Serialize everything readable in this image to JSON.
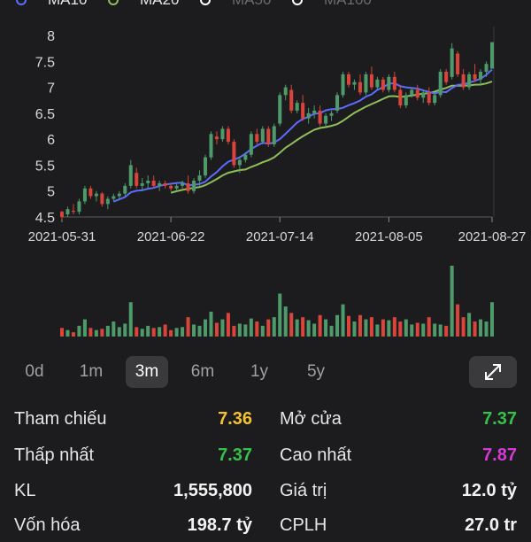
{
  "legend": [
    {
      "label": "MA10",
      "color": "#5b6cff"
    },
    {
      "label": "MA20",
      "color": "#8fbf5a"
    },
    {
      "label": "MA50",
      "color": "#6b6b6b"
    },
    {
      "label": "MA100",
      "color": "#6b6b6b"
    }
  ],
  "chart_data": {
    "type": "candlestick",
    "x_ticks": [
      "2021-05-31",
      "2021-06-22",
      "2021-07-14",
      "2021-08-05",
      "2021-08-27"
    ],
    "y_ticks": [
      "4.5",
      "5",
      "5.5",
      "6",
      "6.5",
      "7",
      "7.5",
      "8"
    ],
    "ylim": [
      4.5,
      8
    ],
    "up_color": "#4f9a6a",
    "down_color": "#d9443b",
    "candles": [
      [
        4.6,
        4.62,
        4.45,
        4.5
      ],
      [
        4.55,
        4.7,
        4.5,
        4.65
      ],
      [
        4.62,
        4.75,
        4.55,
        4.6
      ],
      [
        4.6,
        4.85,
        4.55,
        4.8
      ],
      [
        4.8,
        5.1,
        4.75,
        5.05
      ],
      [
        5.05,
        5.1,
        4.85,
        4.9
      ],
      [
        4.9,
        5.0,
        4.8,
        4.95
      ],
      [
        4.95,
        4.98,
        4.7,
        4.75
      ],
      [
        4.75,
        4.9,
        4.65,
        4.85
      ],
      [
        4.85,
        4.95,
        4.8,
        4.9
      ],
      [
        4.9,
        5.0,
        4.85,
        4.95
      ],
      [
        4.95,
        5.15,
        4.9,
        5.1
      ],
      [
        5.1,
        5.6,
        5.05,
        5.5
      ],
      [
        5.35,
        5.45,
        5.05,
        5.1
      ],
      [
        5.1,
        5.25,
        5.0,
        5.15
      ],
      [
        5.15,
        5.3,
        5.05,
        5.2
      ],
      [
        5.2,
        5.3,
        5.05,
        5.1
      ],
      [
        5.1,
        5.2,
        5.0,
        5.15
      ],
      [
        5.15,
        5.2,
        5.05,
        5.1
      ],
      [
        5.1,
        5.15,
        5.0,
        5.05
      ],
      [
        5.05,
        5.15,
        5.0,
        5.1
      ],
      [
        5.1,
        5.2,
        5.05,
        5.15
      ],
      [
        5.15,
        5.3,
        4.95,
        5.0
      ],
      [
        5.0,
        5.25,
        4.95,
        5.2
      ],
      [
        5.2,
        5.4,
        5.1,
        5.3
      ],
      [
        5.3,
        5.7,
        5.25,
        5.65
      ],
      [
        5.65,
        6.15,
        5.6,
        6.1
      ],
      [
        6.05,
        6.15,
        5.9,
        6.0
      ],
      [
        6.0,
        6.25,
        5.95,
        6.2
      ],
      [
        6.2,
        6.25,
        5.9,
        5.95
      ],
      [
        5.95,
        6.0,
        5.45,
        5.5
      ],
      [
        5.5,
        5.65,
        5.35,
        5.6
      ],
      [
        5.6,
        5.75,
        5.55,
        5.7
      ],
      [
        5.7,
        6.15,
        5.65,
        6.1
      ],
      [
        6.1,
        6.2,
        5.9,
        5.95
      ],
      [
        5.95,
        6.25,
        5.9,
        6.2
      ],
      [
        6.2,
        6.25,
        5.85,
        5.9
      ],
      [
        5.9,
        6.3,
        5.85,
        6.25
      ],
      [
        6.3,
        6.9,
        6.25,
        6.85
      ],
      [
        6.85,
        7.05,
        6.75,
        7.0
      ],
      [
        6.95,
        7.05,
        6.5,
        6.55
      ],
      [
        6.55,
        6.75,
        6.5,
        6.7
      ],
      [
        6.7,
        6.85,
        6.35,
        6.4
      ],
      [
        6.4,
        6.6,
        6.3,
        6.5
      ],
      [
        6.5,
        6.65,
        6.4,
        6.55
      ],
      [
        6.55,
        6.65,
        6.25,
        6.3
      ],
      [
        6.3,
        6.5,
        6.25,
        6.45
      ],
      [
        6.45,
        6.55,
        6.35,
        6.5
      ],
      [
        6.55,
        6.9,
        6.5,
        6.85
      ],
      [
        6.85,
        7.3,
        6.8,
        7.25
      ],
      [
        7.25,
        7.3,
        7.0,
        7.05
      ],
      [
        7.05,
        7.15,
        6.95,
        7.1
      ],
      [
        7.1,
        7.25,
        6.85,
        6.9
      ],
      [
        6.9,
        7.3,
        6.85,
        7.25
      ],
      [
        7.25,
        7.4,
        6.95,
        7.0
      ],
      [
        7.0,
        7.2,
        6.95,
        7.15
      ],
      [
        7.15,
        7.2,
        6.9,
        6.95
      ],
      [
        6.95,
        7.25,
        6.9,
        7.2
      ],
      [
        7.2,
        7.3,
        6.9,
        6.95
      ],
      [
        6.95,
        7.05,
        6.6,
        6.65
      ],
      [
        6.65,
        6.9,
        6.6,
        6.85
      ],
      [
        6.85,
        7.0,
        6.8,
        6.95
      ],
      [
        6.95,
        7.05,
        6.75,
        6.8
      ],
      [
        6.8,
        6.95,
        6.7,
        6.9
      ],
      [
        6.9,
        7.0,
        6.65,
        6.7
      ],
      [
        6.7,
        6.9,
        6.65,
        6.85
      ],
      [
        6.85,
        7.35,
        6.8,
        7.3
      ],
      [
        7.3,
        7.35,
        7.05,
        7.1
      ],
      [
        7.2,
        7.85,
        7.15,
        7.75
      ],
      [
        7.65,
        7.7,
        7.2,
        7.25
      ],
      [
        7.25,
        7.35,
        6.95,
        7.0
      ],
      [
        7.0,
        7.3,
        6.95,
        7.25
      ],
      [
        7.25,
        7.45,
        7.1,
        7.15
      ],
      [
        7.15,
        7.35,
        7.05,
        7.3
      ],
      [
        7.3,
        7.5,
        7.2,
        7.45
      ],
      [
        7.36,
        7.87,
        7.37,
        7.87
      ]
    ],
    "volumes": [
      20,
      15,
      10,
      25,
      40,
      20,
      15,
      18,
      25,
      35,
      22,
      30,
      80,
      22,
      18,
      25,
      20,
      22,
      28,
      15,
      20,
      22,
      45,
      28,
      25,
      40,
      58,
      32,
      40,
      55,
      25,
      30,
      28,
      42,
      35,
      25,
      40,
      45,
      100,
      70,
      55,
      40,
      45,
      38,
      30,
      50,
      40,
      25,
      50,
      75,
      48,
      35,
      50,
      40,
      45,
      28,
      40,
      38,
      45,
      35,
      40,
      28,
      32,
      30,
      45,
      30,
      28,
      25,
      165,
      75,
      45,
      55,
      35,
      40,
      35,
      80
    ]
  },
  "ranges": [
    "0d",
    "1m",
    "3m",
    "6m",
    "1y",
    "5y"
  ],
  "active_range": "3m",
  "stats": [
    [
      {
        "label": "Tham chiếu",
        "value": "7.36",
        "color": "#f2c230"
      },
      {
        "label": "Mở cửa",
        "value": "7.37",
        "color": "#36c24a"
      }
    ],
    [
      {
        "label": "Thấp nhất",
        "value": "7.37",
        "color": "#36c24a"
      },
      {
        "label": "Cao nhất",
        "value": "7.87",
        "color": "#d63ad6"
      }
    ],
    [
      {
        "label": "KL",
        "value": "1,555,800",
        "color": "#f2f2f2"
      },
      {
        "label": "Giá trị",
        "value": "12.0 tỷ",
        "color": "#f2f2f2"
      }
    ],
    [
      {
        "label": "Vốn hóa",
        "value": "198.7 tỷ",
        "color": "#f2f2f2"
      },
      {
        "label": "CPLH",
        "value": "27.0 tr",
        "color": "#f2f2f2"
      }
    ]
  ]
}
